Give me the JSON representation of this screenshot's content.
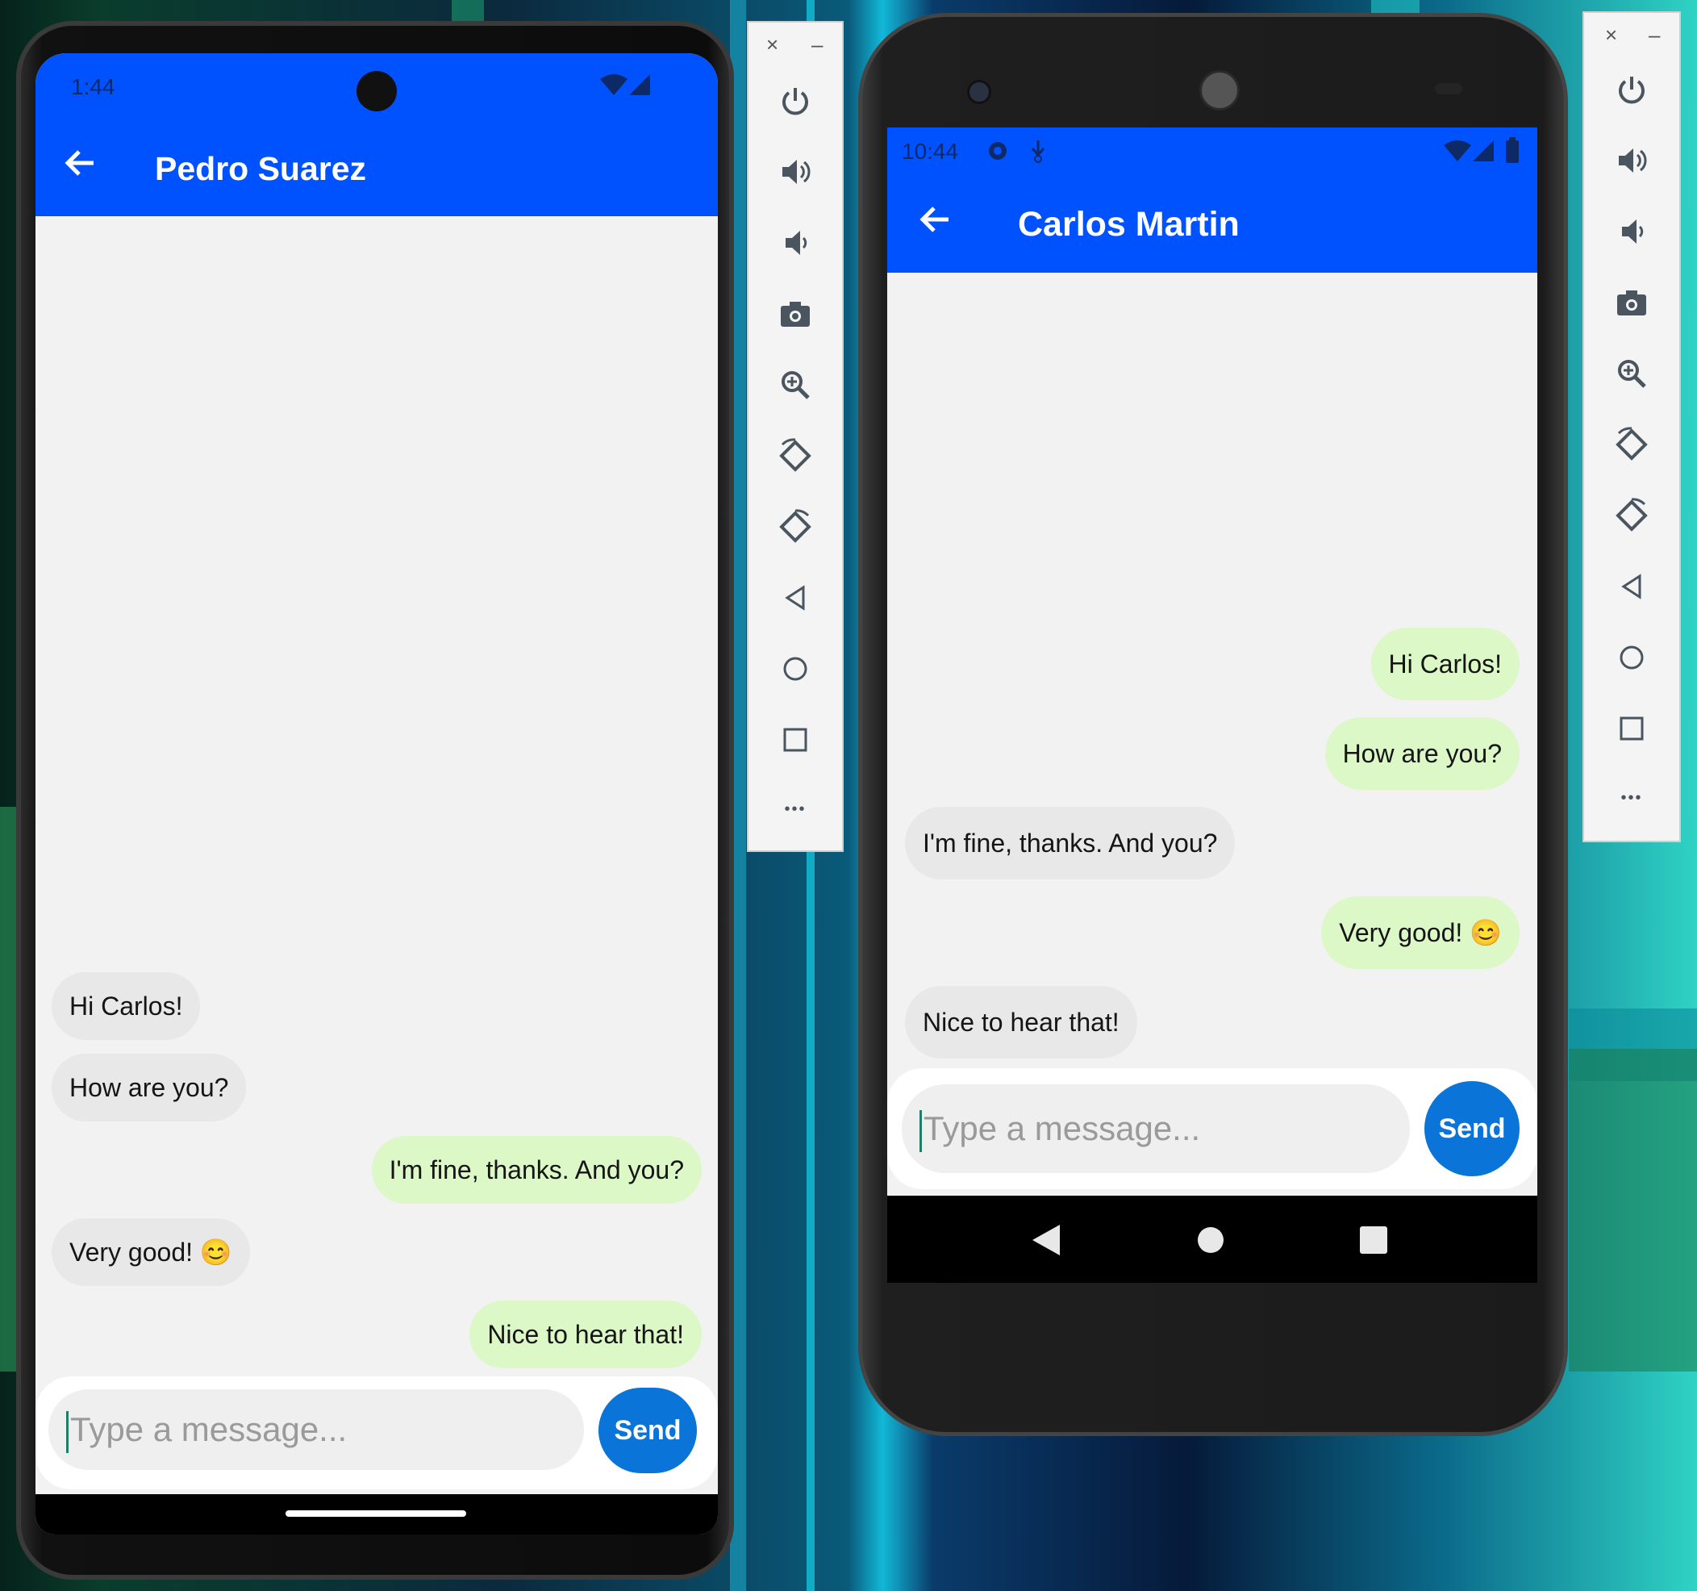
{
  "phone1": {
    "status_time": "1:44",
    "contact_name": "Pedro Suarez",
    "messages": [
      {
        "text": "Hi Carlos!",
        "side": "in"
      },
      {
        "text": "How are you?",
        "side": "in"
      },
      {
        "text": "I'm fine, thanks. And you?",
        "side": "out"
      },
      {
        "text": "Very good! 😊",
        "side": "in"
      },
      {
        "text": "Nice to hear that!",
        "side": "out"
      }
    ],
    "input_placeholder": "Type a message...",
    "send_label": "Send"
  },
  "phone2": {
    "status_time": "10:44",
    "contact_name": "Carlos Martin",
    "messages": [
      {
        "text": "Hi Carlos!",
        "side": "out"
      },
      {
        "text": "How are you?",
        "side": "out"
      },
      {
        "text": "I'm fine, thanks. And you?",
        "side": "in"
      },
      {
        "text": "Very good! 😊",
        "side": "out"
      },
      {
        "text": "Nice to hear that!",
        "side": "in"
      }
    ],
    "input_placeholder": "Type a message...",
    "send_label": "Send"
  },
  "emulator_toolbar": {
    "window_buttons": [
      "close-icon",
      "minimize-icon"
    ],
    "close_glyph": "×",
    "minimize_glyph": "–",
    "more_glyph": "•••",
    "items": [
      "power-icon",
      "volume-up-icon",
      "volume-down-icon",
      "camera-icon",
      "zoom-icon",
      "rotate-left-icon",
      "rotate-right-icon",
      "back-icon",
      "home-icon",
      "overview-icon",
      "more-icon"
    ]
  },
  "colors": {
    "app_bar": "#0052ff",
    "bubble_incoming": "#e8e8e8",
    "bubble_outgoing": "#dcf8c6",
    "send_button": "#0a74d8",
    "chat_background": "#f2f2f2"
  }
}
